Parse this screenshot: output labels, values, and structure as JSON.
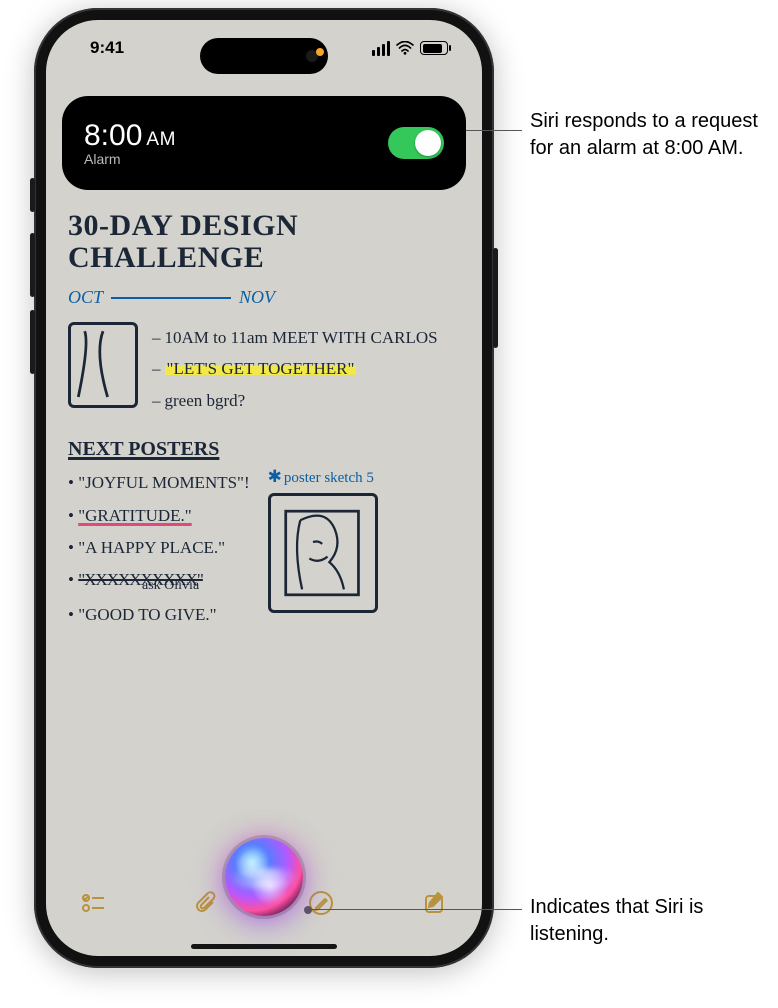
{
  "status": {
    "time": "9:41"
  },
  "alarm": {
    "time": "8:00",
    "ampm": "AM",
    "label": "Alarm",
    "enabled": true
  },
  "note": {
    "title_line1": "30-DAY DESIGN",
    "title_line2": "CHALLENGE",
    "timeline_start": "OCT",
    "timeline_end": "NOV",
    "bullets": [
      "10AM to 11am MEET WITH CARLOS",
      "\"LET'S GET TOGETHER\"",
      "green bgrd?"
    ],
    "next_posters_heading": "NEXT POSTERS",
    "posters": [
      "\"JOYFUL MOMENTS\"!",
      "\"GRATITUDE.\"",
      "\"A HAPPY PLACE.\"",
      "\"XXXXXXXXXX\"",
      "\"GOOD TO GIVE.\""
    ],
    "sketch_label": "poster sketch 5",
    "ask": "ask Olivia"
  },
  "toolbar": {
    "checklist": "checklist",
    "attach": "attach",
    "markup": "markup",
    "compose": "compose"
  },
  "callouts": {
    "top": "Siri responds to a request for an alarm at 8:00 AM.",
    "bottom": "Indicates that Siri is listening."
  },
  "colors": {
    "accent_green": "#34c759",
    "ink": "#1b2636",
    "blue_ink": "#0b5fa5",
    "highlight": "#f2e84a",
    "pink_underline": "#e04a7a",
    "toolbar_gold": "#b9923d"
  }
}
